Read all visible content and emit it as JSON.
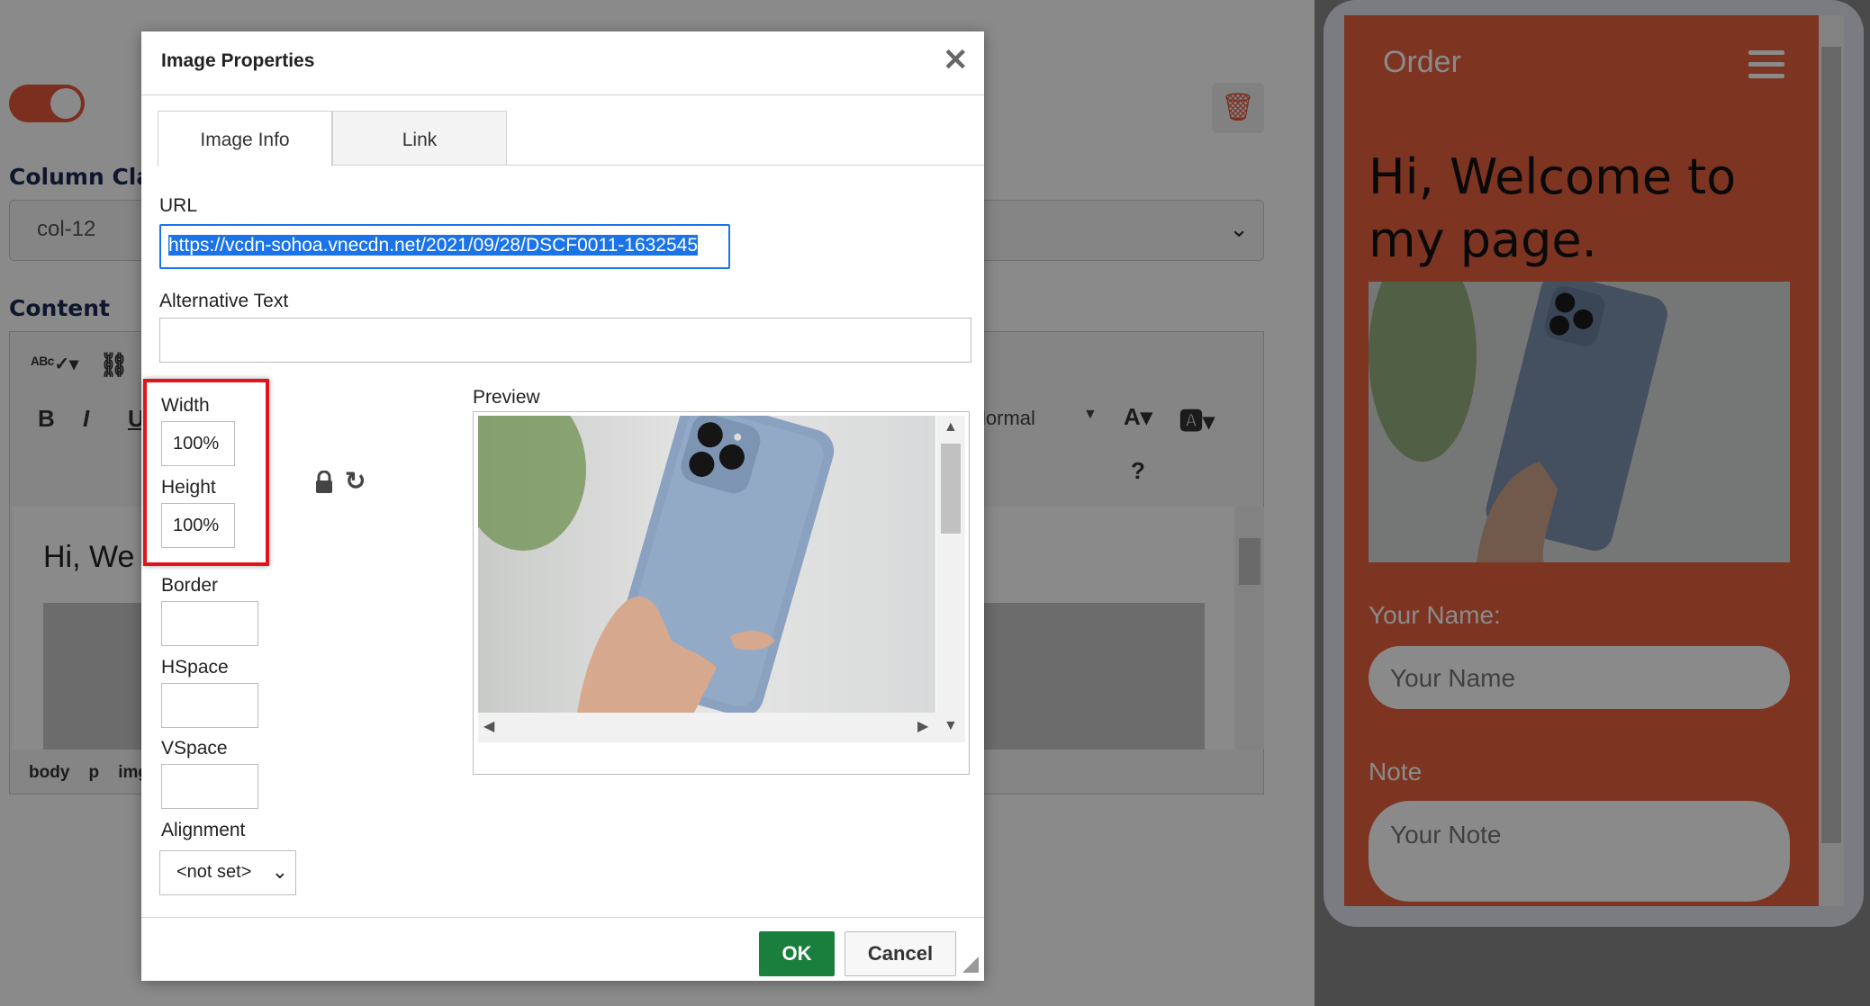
{
  "editor": {
    "column_class_label": "Column Clas",
    "column_class_value": "col-12",
    "content_label": "Content",
    "toolbar": {
      "bold": "B",
      "italic": "I",
      "underline": "U",
      "format": "lormal",
      "help": "?"
    },
    "content_heading": "Hi, We",
    "statusbar": [
      "body",
      "p",
      "img"
    ]
  },
  "phone": {
    "header_title": "Order",
    "heading": "Hi, Welcome to my page.",
    "name_label": "Your Name:",
    "name_placeholder": "Your Name",
    "note_label": "Note",
    "note_placeholder": "Your Note"
  },
  "dialog": {
    "title": "Image Properties",
    "close_glyph": "✕",
    "tabs": [
      {
        "label": "Image Info",
        "active": true
      },
      {
        "label": "Link",
        "active": false
      }
    ],
    "url_label": "URL",
    "url_value": "https://vcdn-sohoa.vnecdn.net/2021/09/28/DSCF0011-1632545",
    "alt_label": "Alternative Text",
    "alt_value": "",
    "width_label": "Width",
    "width_value": "100%",
    "height_label": "Height",
    "height_value": "100%",
    "border_label": "Border",
    "hspace_label": "HSpace",
    "vspace_label": "VSpace",
    "alignment_label": "Alignment",
    "alignment_value": "<not set>",
    "preview_label": "Preview",
    "ok_label": "OK",
    "cancel_label": "Cancel"
  },
  "colors": {
    "accent_orange": "#e8603e",
    "ok_green": "#1a7f3c",
    "highlight_red": "#e0151c",
    "selection_blue": "#1a73e8"
  }
}
